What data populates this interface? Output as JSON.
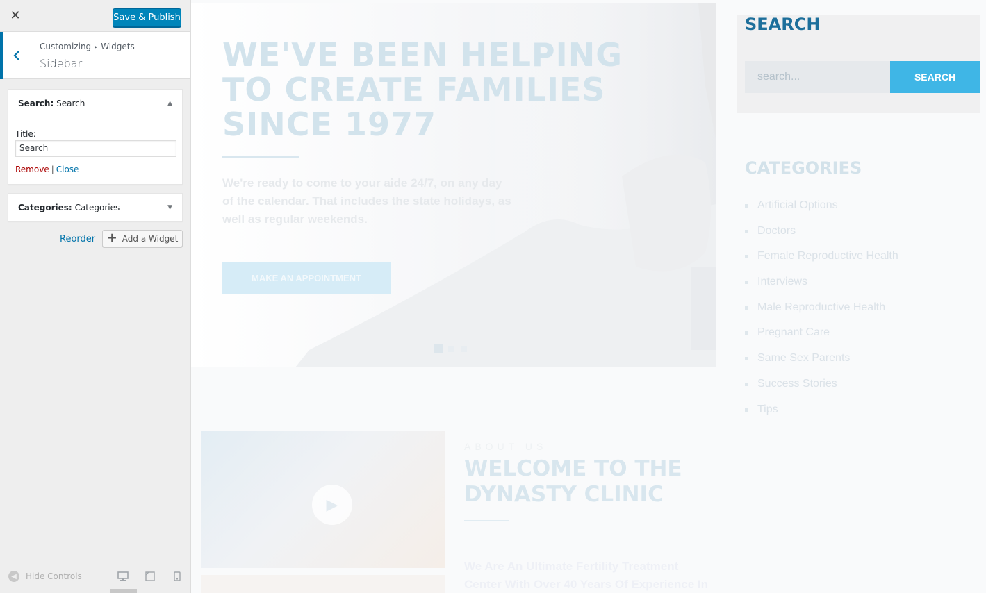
{
  "customizer": {
    "close_icon": "✕",
    "publish_label": "Save & Publish",
    "breadcrumb": {
      "root": "Customizing",
      "separator": "▸",
      "section": "Widgets"
    },
    "panel_title": "Sidebar",
    "widgets": [
      {
        "name_strong": "Search:",
        "name_title": "Search",
        "expanded": true,
        "field_label": "Title:",
        "field_value": "Search",
        "remove_label": "Remove",
        "separator": "|",
        "close_label": "Close"
      },
      {
        "name_strong": "Categories:",
        "name_title": "Categories",
        "expanded": false
      }
    ],
    "reorder_label": "Reorder",
    "add_widget_label": "Add a Widget",
    "footer": {
      "hide_controls_label": "Hide Controls",
      "devices": [
        "desktop-icon",
        "tablet-icon",
        "mobile-icon"
      ],
      "active_device": "desktop"
    },
    "colors": {
      "accent": "#0073aa",
      "publish": "#0085ba",
      "remove": "#aa0000"
    }
  },
  "preview": {
    "hero": {
      "heading": "WE'VE BEEN HELPING\nTO CREATE FAMILIES\nSINCE 1977",
      "text": "We're ready to come to your aide 24/7, on any day of the calendar. That includes the state holidays, as well as regular weekends.",
      "button_label": "MAKE AN APPOINTMENT",
      "slides": 3,
      "active_slide": 1
    },
    "about": {
      "eyebrow": "ABOUT US",
      "heading": "WELCOME TO THE\nDYNASTY CLINIC",
      "text": "We Are An Ultimate Fertility Treatment Center With Over 40 Years Of Experience In Sex-"
    },
    "sidebar": {
      "search_title": "SEARCH",
      "search_placeholder": "search...",
      "search_button": "SEARCH",
      "categories_title": "CATEGORIES",
      "categories": [
        "Artificial Options",
        "Doctors",
        "Female Reproductive Health",
        "Interviews",
        "Male Reproductive Health",
        "Pregnant Care",
        "Same Sex Parents",
        "Success Stories",
        "Tips"
      ]
    },
    "colors": {
      "search_title": "#1d6f9b",
      "search_button": "#3fb6e6"
    }
  }
}
